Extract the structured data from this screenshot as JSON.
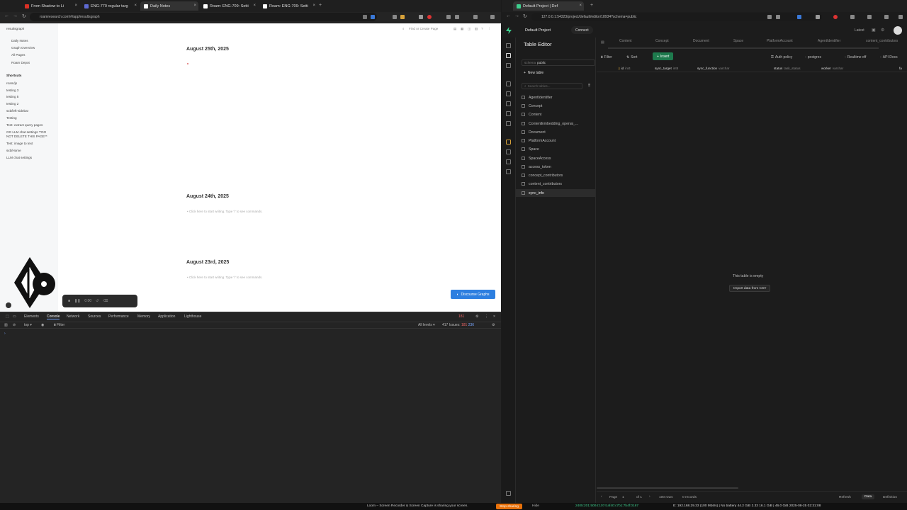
{
  "left_browser": {
    "tabs": [
      {
        "label": "From Shadow to Li",
        "favicon_color": "#d93025"
      },
      {
        "label": "ENG-770 regular targ",
        "favicon_color": "#5e6ad2"
      },
      {
        "label": "Daily Notes",
        "favicon_color": "#ffffff"
      },
      {
        "label": "Roam: ENG-709: Setti",
        "favicon_color": "#ffffff"
      },
      {
        "label": "Roam: ENG-709: Setti",
        "favicon_color": "#ffffff"
      }
    ],
    "new_tab": "+",
    "url": "roamresearch.com/#/app/resultsgraph"
  },
  "roam": {
    "graph_name": "resultsgraph",
    "search_placeholder": "Find or Create Page",
    "nav": [
      "Daily Notes",
      "Graph Overview",
      "All Pages",
      "Roam Depot"
    ],
    "shortcuts_heading": "Shortcuts",
    "shortcuts": [
      "roam/js",
      "testing 3",
      "testing 5",
      "testing 2",
      "sxb/left-sidebar",
      "Testing",
      "Test: extract query pages",
      "OG LLM chat settings **DO",
      "NOT DELETE THIS PAGE**",
      "Test: image to text",
      "sxb/Home",
      "LLM chat settings"
    ],
    "dates": [
      {
        "title": "August 25th, 2025",
        "placeholder": ""
      },
      {
        "title": "August 24th, 2025",
        "placeholder": "Click here to start writing. Type '/' to see commands."
      },
      {
        "title": "August 23rd, 2025",
        "placeholder": "Click here to start writing. Type '/' to see commands."
      }
    ],
    "discourse_button": "Discourse Graphs",
    "recorder_time": "0:00"
  },
  "devtools": {
    "tabs": [
      "Elements",
      "Console",
      "Network",
      "Sources",
      "Performance",
      "Memory",
      "Application",
      "Lighthouse"
    ],
    "active_tab": "Console",
    "context": "top",
    "filter_placeholder": "Filter",
    "levels": "All levels",
    "issues": "417 Issues:",
    "issue_counts": [
      "181",
      "236"
    ],
    "error_count": "181"
  },
  "right_browser": {
    "tab": {
      "label": "Default Project | Def"
    },
    "url": "127.0.0.1:54323/project/default/editor/18934?schema=public",
    "project": "Default Project",
    "connect": "Connect",
    "latest": "Latest",
    "page_title": "Table Editor",
    "schema_label": "schema",
    "schema_value": "public",
    "new_table": "New table",
    "search_placeholder": "Search tables...",
    "tables": [
      "AgentIdentifier",
      "Concept",
      "Content",
      "ContentEmbedding_openai_...",
      "Document",
      "PlatformAccount",
      "Space",
      "SpaceAccess",
      "access_token",
      "concept_contributors",
      "content_contributors",
      "sync_info"
    ],
    "active_table": "sync_info",
    "open_tabs": [
      "Content",
      "Concept",
      "Document",
      "Space",
      "PlatformAccount",
      "AgentIdentifier",
      "content_contributors"
    ],
    "toolbar": {
      "filter": "Filter",
      "sort": "Sort",
      "insert": "Insert",
      "auth_policy": "Auth policy",
      "role": "postgres",
      "realtime": "Realtime off",
      "api_docs": "API Docs"
    },
    "columns": [
      {
        "name": "id",
        "type": "int4"
      },
      {
        "name": "sync_target",
        "type": "int8"
      },
      {
        "name": "sync_function",
        "type": "varchar"
      },
      {
        "name": "status",
        "type": "task_status"
      },
      {
        "name": "worker",
        "type": "varchar"
      },
      {
        "name": "fa",
        "type": ""
      }
    ],
    "empty_message": "This table is empty",
    "import_button": "Import data from CSV",
    "footer": {
      "page_label": "Page",
      "page": "1",
      "of": "of 1",
      "rows": "100 rows",
      "records": "0 records",
      "refresh": "Refresh",
      "data_tab": "Data",
      "definition_tab": "Definition"
    }
  },
  "system_bar": {
    "share_notice": "Loom – Screen Recorder & Screen Capture is sharing your screen.",
    "stop_sharing": "Stop sharing",
    "hide": "Hide",
    "status_line": "2405:201:5004:1074:af40:c7b1:7b4f:0167",
    "status_right": "E: 192.168.29.33 (100 Mbit/s) | No battery 44.2 GiB 2.33 16.1 GiB | 46.0 GiB 2025-08-25 02:31:08",
    "colors": {
      "accent_green": "#3ecf8e",
      "stop_orange": "#e8710a",
      "loom_blue": "#2d7fe0"
    }
  }
}
